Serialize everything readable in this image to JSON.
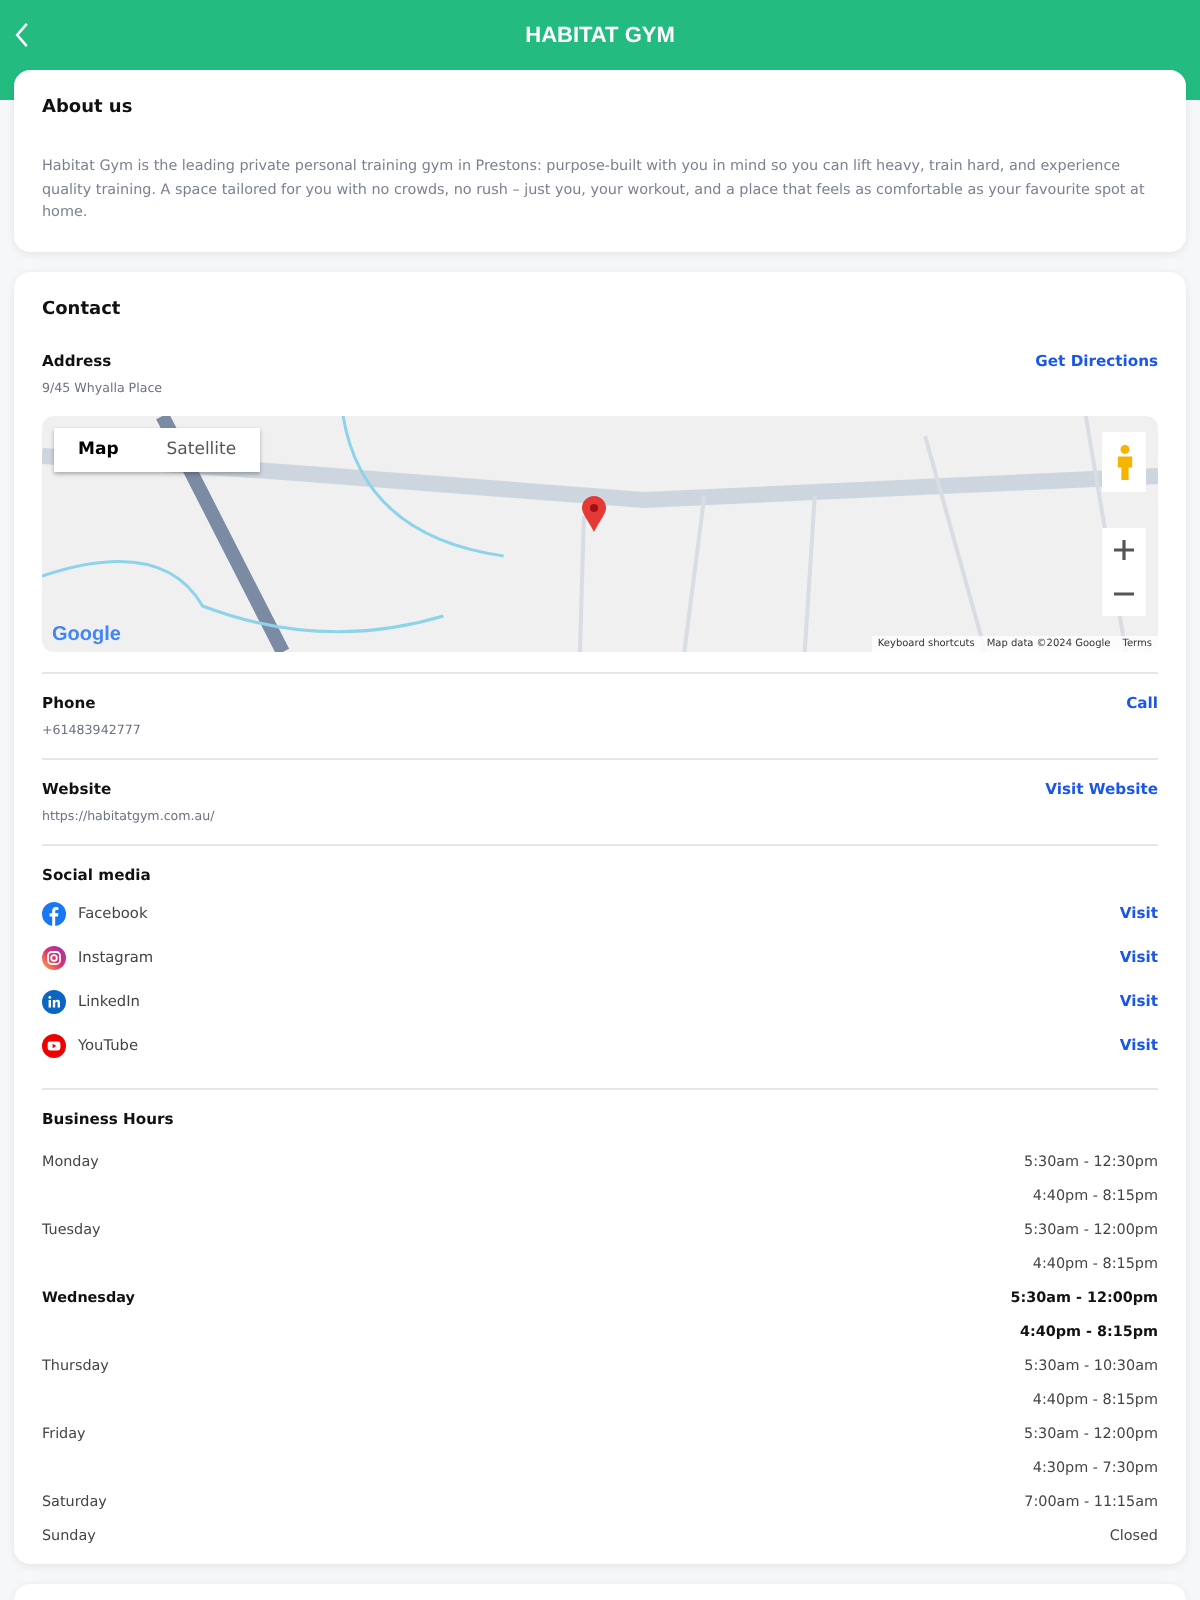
{
  "header": {
    "title": "HABITAT GYM"
  },
  "about": {
    "title": "About us",
    "text": "Habitat Gym is the leading private personal training gym in Prestons: purpose-built with you in mind so you can lift heavy, train hard, and experience quality training. A space tailored for you with no crowds, no rush – just you, your workout, and a place that feels as comfortable as your favourite spot at home."
  },
  "contact": {
    "title": "Contact",
    "address": {
      "label": "Address",
      "value": "9/45 Whyalla Place",
      "action": "Get Directions"
    },
    "map": {
      "types": [
        {
          "label": "Map",
          "selected": true
        },
        {
          "label": "Satellite",
          "selected": false
        }
      ],
      "logo": "Google",
      "footer": [
        "Keyboard shortcuts",
        "Map data ©2024 Google",
        "Terms"
      ]
    },
    "phone": {
      "label": "Phone",
      "value": "+61483942777",
      "action": "Call"
    },
    "website": {
      "label": "Website",
      "value": "https://habitatgym.com.au/",
      "action": "Visit Website"
    },
    "social": {
      "title": "Social media",
      "items": [
        {
          "kind": "facebook",
          "name": "Facebook",
          "action": "Visit"
        },
        {
          "kind": "instagram",
          "name": "Instagram",
          "action": "Visit"
        },
        {
          "kind": "linkedin",
          "name": "LinkedIn",
          "action": "Visit"
        },
        {
          "kind": "youtube",
          "name": "YouTube",
          "action": "Visit"
        }
      ]
    },
    "hours": {
      "title": "Business Hours",
      "days": [
        {
          "day": "Monday",
          "today": false,
          "slots": [
            "5:30am - 12:30pm",
            "4:40pm - 8:15pm"
          ]
        },
        {
          "day": "Tuesday",
          "today": false,
          "slots": [
            "5:30am - 12:00pm",
            "4:40pm - 8:15pm"
          ]
        },
        {
          "day": "Wednesday",
          "today": true,
          "slots": [
            "5:30am - 12:00pm",
            "4:40pm - 8:15pm"
          ]
        },
        {
          "day": "Thursday",
          "today": false,
          "slots": [
            "5:30am - 10:30am",
            "4:40pm - 8:15pm"
          ]
        },
        {
          "day": "Friday",
          "today": false,
          "slots": [
            "5:30am - 12:00pm",
            "4:30pm - 7:30pm"
          ]
        },
        {
          "day": "Saturday",
          "today": false,
          "slots": [
            "7:00am - 11:15am"
          ]
        },
        {
          "day": "Sunday",
          "today": false,
          "slots": [
            "Closed"
          ]
        }
      ]
    }
  }
}
